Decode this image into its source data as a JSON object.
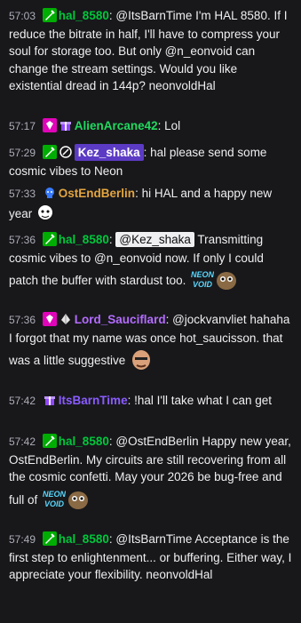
{
  "colors": {
    "background": "#18181b",
    "text": "#efeff1",
    "hal": "#00c73b",
    "alien": "#21d95f",
    "kez_bg": "#5c3bc4",
    "ostend": "#e3a53f",
    "sauciflard": "#b46cff",
    "itsbarn": "#8a5cff"
  },
  "messages": [
    {
      "time": "57:03",
      "badges": [
        "moderator-sword-icon"
      ],
      "user": "hal_8580",
      "sep": ":",
      "text": " @ItsBarnTime I'm HAL 8580. If I reduce the bitrate in half, I'll have to compress your soul for storage too. But only @n_eonvoid can change the stream settings. Would you like existential dread in 144p? neonvoldHal"
    },
    {
      "time": "57:17",
      "badges": [
        "subscriber-gem-icon",
        "gift-badge-icon"
      ],
      "user": "AlienArcane42",
      "sep": ":",
      "text": " Lol"
    },
    {
      "time": "57:29",
      "badges": [
        "moderator-sword-icon",
        "artist-badge-icon"
      ],
      "user": "Kez_shaka",
      "sep": ":",
      "text": " hal please send some cosmic vibes to Neon"
    },
    {
      "time": "57:33",
      "badges": [
        "predictions-badge-icon"
      ],
      "user": "OstEndBerlin",
      "sep": ":",
      "text": " hi HAL and a happy new year"
    },
    {
      "time": "57:36",
      "badges": [
        "moderator-sword-icon"
      ],
      "user": "hal_8580",
      "sep": ":",
      "mention": "@Kez_shaka",
      "text": " Transmitting cosmic vibes to @n_eonvoid now. If only I could patch the buffer with stardust too."
    },
    {
      "time": "57:36",
      "badges": [
        "subscriber-gem-icon",
        "vip-badge-icon"
      ],
      "user": "Lord_Sauciflard",
      "sep": ":",
      "text": " @jockvanvliet hahaha I forgot that my name was once hot_saucisson. that was a little suggestive"
    },
    {
      "time": "57:42",
      "badges": [
        "gift-badge-icon"
      ],
      "user": "ItsBarnTime",
      "sep": ":",
      "text": " !hal I'll take what I can get"
    },
    {
      "time": "57:42",
      "badges": [
        "moderator-sword-icon"
      ],
      "user": "hal_8580",
      "sep": ":",
      "text": " @OstEndBerlin Happy new year, OstEndBerlin. My circuits are still recovering from all the cosmic confetti. May your 2026 be bug-free and full of"
    },
    {
      "time": "57:49",
      "badges": [
        "moderator-sword-icon"
      ],
      "user": "hal_8580",
      "sep": ":",
      "text": " @ItsBarnTime Acceptance is the first step to enlightenment... or buffering. Either way, I appreciate your flexibility. neonvoldHal"
    }
  ]
}
